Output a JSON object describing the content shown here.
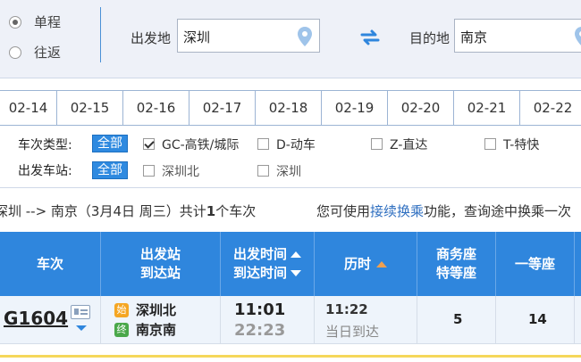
{
  "trip_type": {
    "one_way": "单程",
    "round_trip": "往返",
    "selected": "one_way"
  },
  "from": {
    "label": "出发地",
    "value": "深圳"
  },
  "to": {
    "label": "目的地",
    "value": "南京"
  },
  "dates": [
    "02-14",
    "02-15",
    "02-16",
    "02-17",
    "02-18",
    "02-19",
    "02-20",
    "02-21",
    "02-22"
  ],
  "filters": {
    "train_type_label": "车次类型:",
    "all_label": "全部",
    "train_types": [
      {
        "label": "GC-高铁/城际",
        "checked": true
      },
      {
        "label": "D-动车",
        "checked": false
      },
      {
        "label": "Z-直达",
        "checked": false
      },
      {
        "label": "T-特快",
        "checked": false
      }
    ],
    "station_label": "出发车站:",
    "stations": [
      {
        "label": "深圳北",
        "checked": false
      },
      {
        "label": "深圳",
        "checked": false
      }
    ]
  },
  "summary": {
    "route": "深圳 --> 南京（3月4日  周三）共计",
    "count": "1",
    "suffix": "个车次",
    "hint_prefix": "您可使用",
    "hint_link": "接续换乘",
    "hint_suffix": "功能，查询途中换乘一次"
  },
  "table": {
    "headers": {
      "train": "车次",
      "station_top": "出发站",
      "station_bottom": "到达站",
      "time_top": "出发时间",
      "time_bottom": "到达时间",
      "duration": "历时",
      "business_top": "商务座",
      "business_bottom": "特等座",
      "first_class": "一等座"
    },
    "rows": [
      {
        "train_no": "G1604",
        "start_badge": "始",
        "end_badge": "终",
        "from_station": "深圳北",
        "to_station": "南京南",
        "depart": "11:01",
        "arrive": "22:23",
        "duration": "11:22",
        "arrive_day": "当日到达",
        "business": "5",
        "first_class": "14"
      }
    ]
  },
  "colors": {
    "header_blue": "#2f86dd",
    "accent_blue": "#2f8ae0",
    "link_blue": "#2f6fc0"
  }
}
